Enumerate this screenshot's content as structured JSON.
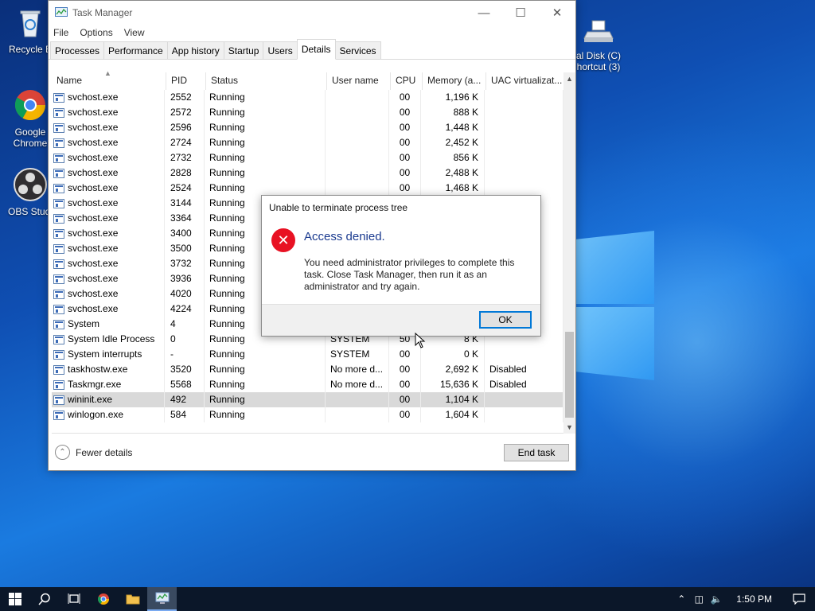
{
  "desktop": {
    "icons": [
      {
        "label": "Recycle B",
        "icon": "recycle-bin-icon"
      },
      {
        "label": "Google Chrome",
        "icon": "chrome-icon"
      },
      {
        "label": "OBS Studi",
        "icon": "obs-icon"
      },
      {
        "label": "al Disk (C) hortcut (3)",
        "icon": "drive-icon"
      }
    ]
  },
  "window": {
    "title": "Task Manager",
    "menu": [
      "File",
      "Options",
      "View"
    ],
    "tabs": [
      "Processes",
      "Performance",
      "App history",
      "Startup",
      "Users",
      "Details",
      "Services"
    ],
    "active_tab": "Details"
  },
  "table": {
    "columns": [
      "Name",
      "PID",
      "Status",
      "User name",
      "CPU",
      "Memory (a...",
      "UAC virtualizat..."
    ],
    "rows": [
      {
        "name": "svchost.exe",
        "pid": "2552",
        "status": "Running",
        "user": "",
        "cpu": "00",
        "mem": "1,196 K",
        "uac": ""
      },
      {
        "name": "svchost.exe",
        "pid": "2572",
        "status": "Running",
        "user": "",
        "cpu": "00",
        "mem": "888 K",
        "uac": ""
      },
      {
        "name": "svchost.exe",
        "pid": "2596",
        "status": "Running",
        "user": "",
        "cpu": "00",
        "mem": "1,448 K",
        "uac": ""
      },
      {
        "name": "svchost.exe",
        "pid": "2724",
        "status": "Running",
        "user": "",
        "cpu": "00",
        "mem": "2,452 K",
        "uac": ""
      },
      {
        "name": "svchost.exe",
        "pid": "2732",
        "status": "Running",
        "user": "",
        "cpu": "00",
        "mem": "856 K",
        "uac": ""
      },
      {
        "name": "svchost.exe",
        "pid": "2828",
        "status": "Running",
        "user": "",
        "cpu": "00",
        "mem": "2,488 K",
        "uac": ""
      },
      {
        "name": "svchost.exe",
        "pid": "2524",
        "status": "Running",
        "user": "",
        "cpu": "00",
        "mem": "1,468 K",
        "uac": ""
      },
      {
        "name": "svchost.exe",
        "pid": "3144",
        "status": "Running",
        "user": "",
        "cpu": "",
        "mem": "",
        "uac": ""
      },
      {
        "name": "svchost.exe",
        "pid": "3364",
        "status": "Running",
        "user": "",
        "cpu": "",
        "mem": "",
        "uac": ""
      },
      {
        "name": "svchost.exe",
        "pid": "3400",
        "status": "Running",
        "user": "",
        "cpu": "",
        "mem": "",
        "uac": ""
      },
      {
        "name": "svchost.exe",
        "pid": "3500",
        "status": "Running",
        "user": "",
        "cpu": "",
        "mem": "",
        "uac": ""
      },
      {
        "name": "svchost.exe",
        "pid": "3732",
        "status": "Running",
        "user": "",
        "cpu": "",
        "mem": "",
        "uac": ""
      },
      {
        "name": "svchost.exe",
        "pid": "3936",
        "status": "Running",
        "user": "",
        "cpu": "",
        "mem": "",
        "uac": ""
      },
      {
        "name": "svchost.exe",
        "pid": "4020",
        "status": "Running",
        "user": "",
        "cpu": "",
        "mem": "",
        "uac": ""
      },
      {
        "name": "svchost.exe",
        "pid": "4224",
        "status": "Running",
        "user": "",
        "cpu": "",
        "mem": "",
        "uac": ""
      },
      {
        "name": "System",
        "pid": "4",
        "status": "Running",
        "user": "",
        "cpu": "",
        "mem": "",
        "uac": ""
      },
      {
        "name": "System Idle Process",
        "pid": "0",
        "status": "Running",
        "user": "SYSTEM",
        "cpu": "50",
        "mem": "8 K",
        "uac": ""
      },
      {
        "name": "System interrupts",
        "pid": "-",
        "status": "Running",
        "user": "SYSTEM",
        "cpu": "00",
        "mem": "0 K",
        "uac": ""
      },
      {
        "name": "taskhostw.exe",
        "pid": "3520",
        "status": "Running",
        "user": "No more d...",
        "cpu": "00",
        "mem": "2,692 K",
        "uac": "Disabled"
      },
      {
        "name": "Taskmgr.exe",
        "pid": "5568",
        "status": "Running",
        "user": "No more d...",
        "cpu": "00",
        "mem": "15,636 K",
        "uac": "Disabled"
      },
      {
        "name": "wininit.exe",
        "pid": "492",
        "status": "Running",
        "user": "",
        "cpu": "00",
        "mem": "1,104 K",
        "uac": "",
        "selected": true
      },
      {
        "name": "winlogon.exe",
        "pid": "584",
        "status": "Running",
        "user": "",
        "cpu": "00",
        "mem": "1,604 K",
        "uac": ""
      }
    ]
  },
  "footer": {
    "fewer_details": "Fewer details",
    "end_task": "End task"
  },
  "dialog": {
    "title": "Unable to terminate process tree",
    "heading": "Access denied.",
    "message": "You need administrator privileges to complete this task. Close Task Manager, then run it as an administrator and try again.",
    "ok": "OK"
  },
  "taskbar": {
    "clock": "1:50 PM"
  },
  "colors": {
    "error": "#e81123",
    "accent": "#0078d7",
    "heading": "#1a3a8f"
  }
}
